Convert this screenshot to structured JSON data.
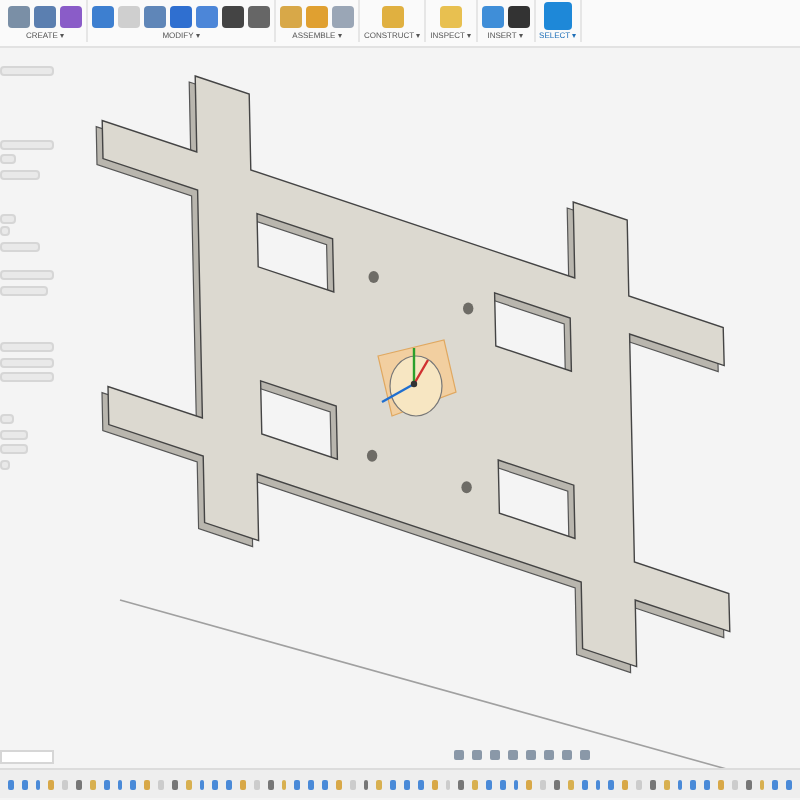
{
  "toolbar": {
    "groups": [
      {
        "label": "CREATE ▾",
        "selected": false
      },
      {
        "label": "MODIFY ▾",
        "selected": false
      },
      {
        "label": "ASSEMBLE ▾",
        "selected": false
      },
      {
        "label": "CONSTRUCT ▾",
        "selected": false
      },
      {
        "label": "INSPECT ▾",
        "selected": false
      },
      {
        "label": "INSERT ▾",
        "selected": false
      },
      {
        "label": "SELECT ▾",
        "selected": true
      }
    ]
  }
}
